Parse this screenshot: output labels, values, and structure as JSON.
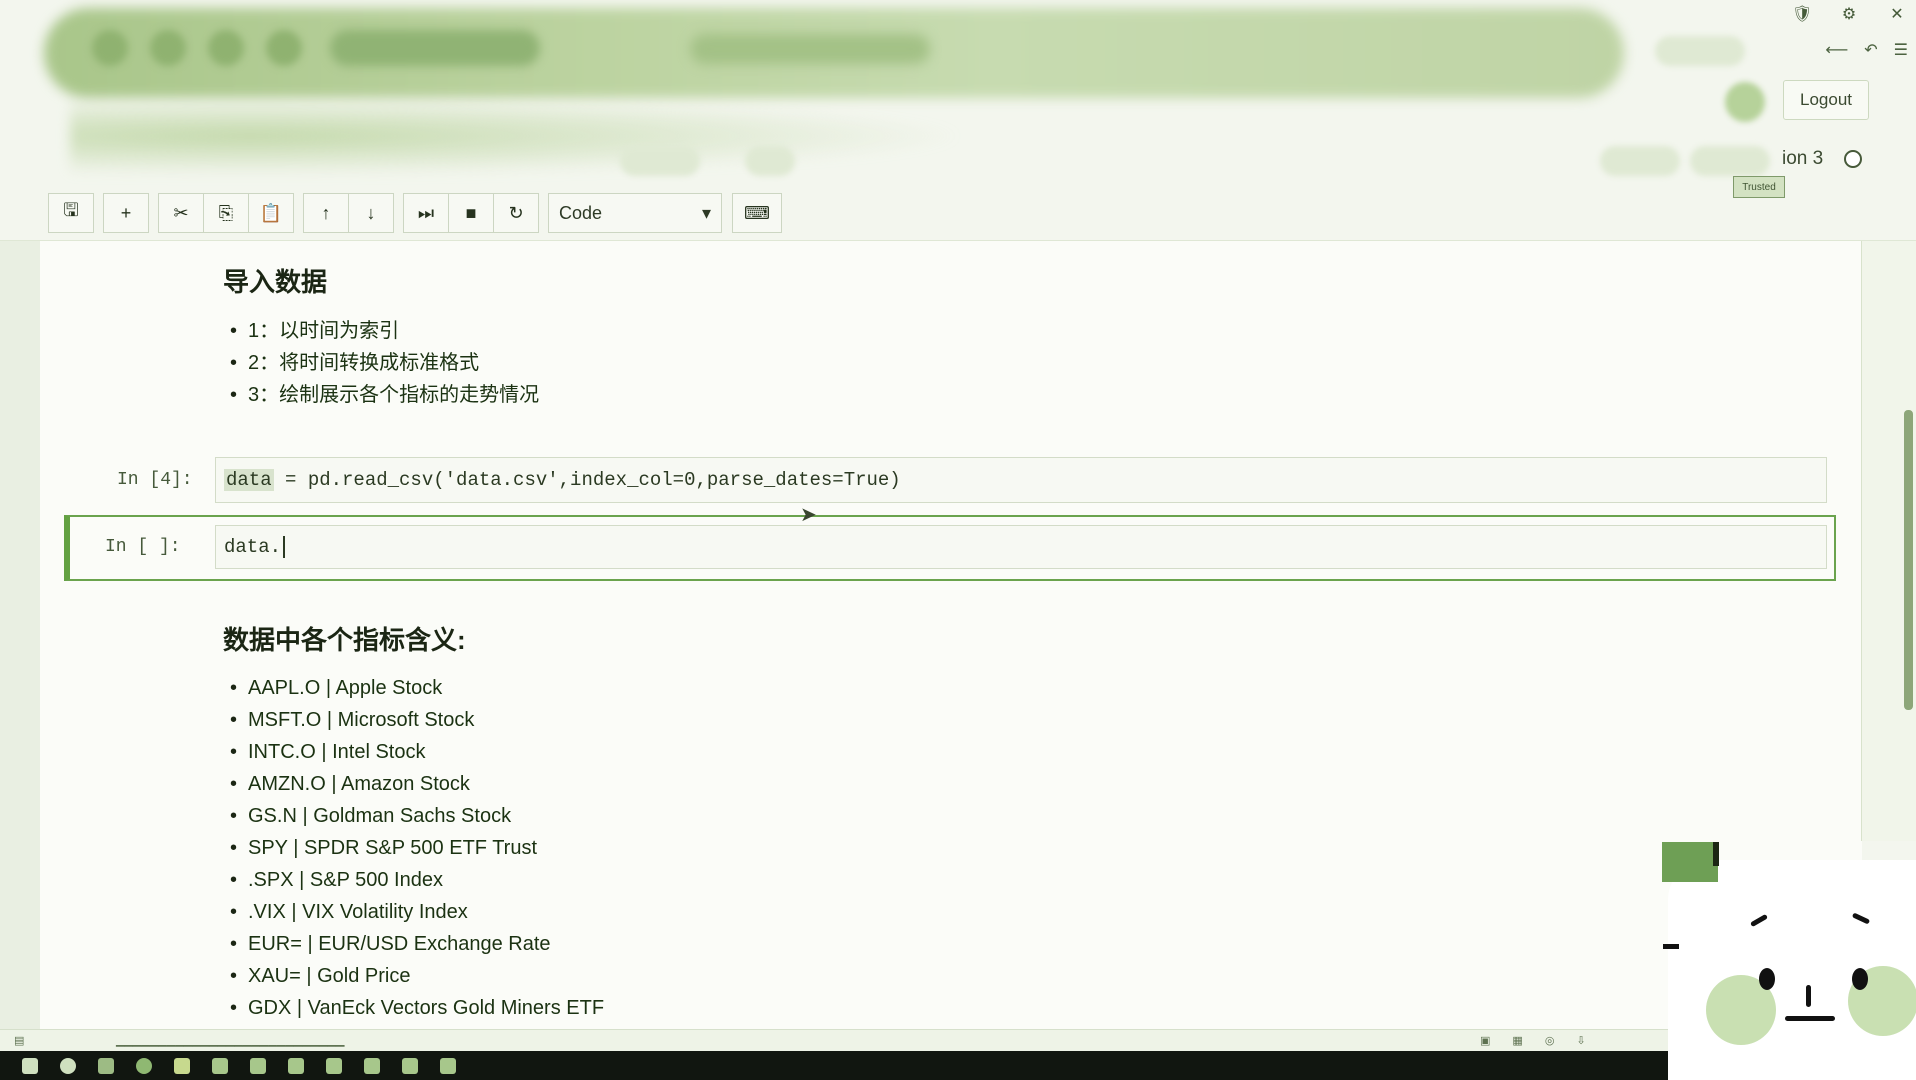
{
  "header": {
    "logout_label": "Logout",
    "kernel_name": "ion 3",
    "trusted_label": "Trusted"
  },
  "window_controls": [
    "🛡",
    "⚙",
    "✕"
  ],
  "toolbar": {
    "buttons": [
      {
        "name": "save-icon",
        "glyph": "🖫"
      },
      {
        "name": "add-cell-icon",
        "glyph": "+"
      },
      {
        "name": "cut-icon",
        "glyph": "✂"
      },
      {
        "name": "copy-icon",
        "glyph": "⎘"
      },
      {
        "name": "paste-icon",
        "glyph": "📋"
      },
      {
        "name": "move-up-icon",
        "glyph": "↑"
      },
      {
        "name": "move-down-icon",
        "glyph": "↓"
      },
      {
        "name": "run-icon",
        "glyph": "⏭"
      },
      {
        "name": "stop-icon",
        "glyph": "■"
      },
      {
        "name": "restart-icon",
        "glyph": "↻"
      }
    ],
    "cell_type": "Code",
    "cell_type_arrow": "▾",
    "keyboard_glyph": "⌨"
  },
  "notebook": {
    "section1": {
      "title": "导入数据",
      "items": [
        "1：以时间为索引",
        "2：将时间转换成标准格式",
        "3：绘制展示各个指标的走势情况"
      ]
    },
    "cell1": {
      "prompt": "In  [4]:",
      "code_selected": "data",
      "code_rest": " = pd.read_csv('data.csv',index_col=0,parse_dates=True)"
    },
    "cell2": {
      "prompt": "In  [ ]:",
      "code": "data."
    },
    "section2": {
      "title": "数据中各个指标含义:",
      "items": [
        "AAPL.O | Apple Stock",
        "MSFT.O | Microsoft Stock",
        "INTC.O | Intel Stock",
        "AMZN.O | Amazon Stock",
        "GS.N | Goldman Sachs Stock",
        "SPY | SPDR S&P 500 ETF Trust",
        ".SPX | S&P 500 Index",
        ".VIX | VIX Volatility Index",
        "EUR= | EUR/USD Exchange Rate",
        "XAU= | Gold Price",
        "GDX | VanEck Vectors Gold Miners ETF"
      ]
    }
  },
  "colors": {
    "accent_green": "#63a142",
    "link_text": "#1b3212",
    "taskbar": "#111610"
  }
}
